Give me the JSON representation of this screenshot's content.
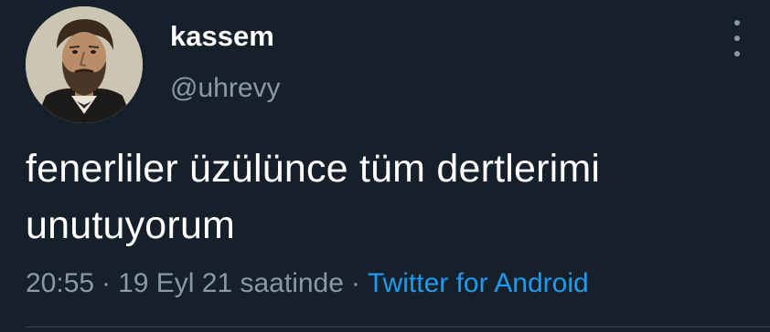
{
  "user": {
    "display_name": "kassem",
    "handle": "@uhrevy",
    "avatar_icon": "bearded-man-portrait-avatar"
  },
  "tweet": {
    "text": "fenerliler üzülünce tüm dertlerimi unutuyorum",
    "time": "20:55",
    "date": "19 Eyl 21 saatinde",
    "separator": "·",
    "source": "Twitter for Android"
  },
  "menu": {
    "icon": "vertical-ellipsis-icon"
  },
  "colors": {
    "background": "#15202b",
    "primary_text": "#ffffff",
    "secondary_text": "#8b98a5",
    "link": "#1d9bf0"
  }
}
